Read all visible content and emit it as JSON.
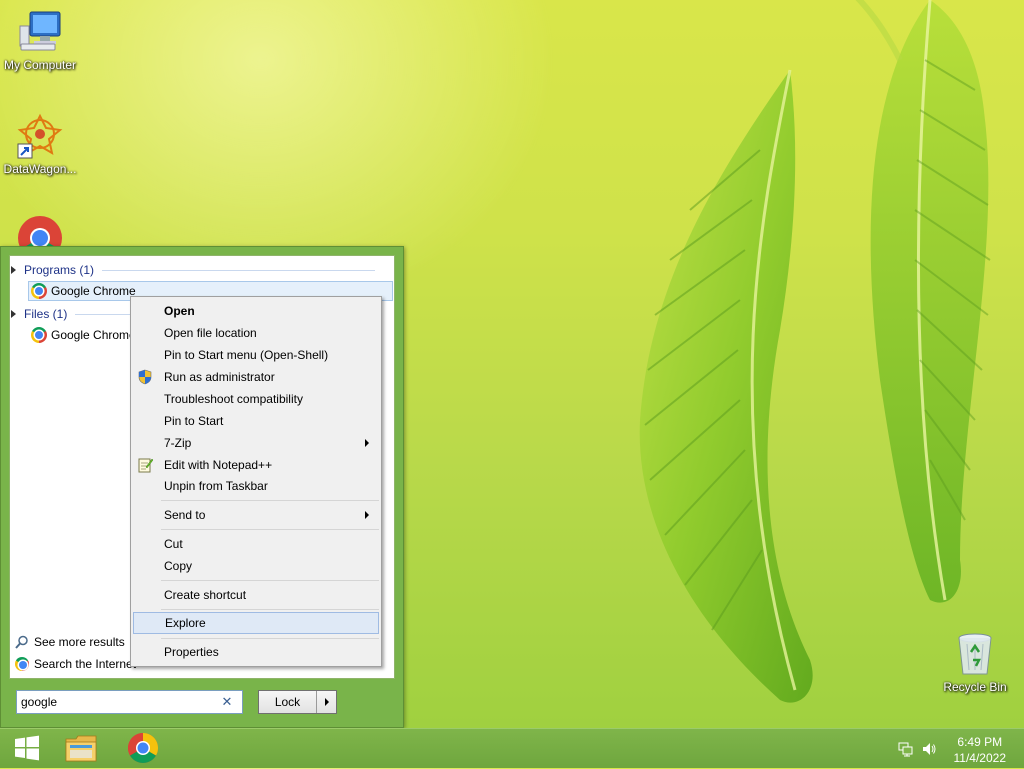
{
  "desktop": {
    "icons": [
      {
        "label": "My Computer",
        "icon": "computer-icon"
      },
      {
        "label": "DataWagon...",
        "icon": "datawagon-icon"
      },
      {
        "label": "",
        "icon": "chrome-icon"
      },
      {
        "label": "Recycle Bin",
        "icon": "recycle-bin-icon"
      }
    ]
  },
  "start_menu": {
    "groups": [
      {
        "label": "Programs (1)",
        "items": [
          {
            "label": "Google Chrome",
            "icon": "chrome-icon",
            "selected": true
          }
        ]
      },
      {
        "label": "Files (1)",
        "items": [
          {
            "label": "Google Chrome",
            "icon": "chrome-icon"
          }
        ]
      }
    ],
    "links": {
      "see_more": "See more results",
      "search_internet": "Search the Internet"
    },
    "search": {
      "value": "google",
      "clear_glyph": "✕"
    },
    "power_button": {
      "label": "Lock"
    }
  },
  "context_menu": {
    "items": [
      {
        "label": "Open",
        "bold": true
      },
      {
        "label": "Open file location"
      },
      {
        "label": "Pin to Start menu (Open-Shell)"
      },
      {
        "label": "Run as administrator",
        "icon": "uac-shield-icon"
      },
      {
        "label": "Troubleshoot compatibility"
      },
      {
        "label": "Pin to Start"
      },
      {
        "label": "7-Zip",
        "submenu": true
      },
      {
        "label": "Edit with Notepad++",
        "icon": "notepad-plus-plus-icon"
      },
      {
        "label": "Unpin from Taskbar"
      },
      {
        "label": "Send to",
        "submenu": true
      },
      {
        "label": "Cut"
      },
      {
        "label": "Copy"
      },
      {
        "label": "Create shortcut"
      },
      {
        "label": "Explore",
        "highlighted": true
      },
      {
        "label": "Properties"
      }
    ]
  },
  "taskbar": {
    "buttons": [
      {
        "name": "start-button",
        "icon": "windows-logo-icon"
      },
      {
        "name": "file-explorer-button",
        "icon": "folder-icon"
      },
      {
        "name": "chrome-button",
        "icon": "chrome-icon"
      }
    ],
    "tray": [
      "network-icon",
      "volume-icon"
    ],
    "clock": {
      "time": "6:49 PM",
      "date": "11/4/2022"
    }
  },
  "colors": {
    "accent": "#79b44a",
    "highlight": "#dfe9f6",
    "group_text": "#1e3287"
  }
}
